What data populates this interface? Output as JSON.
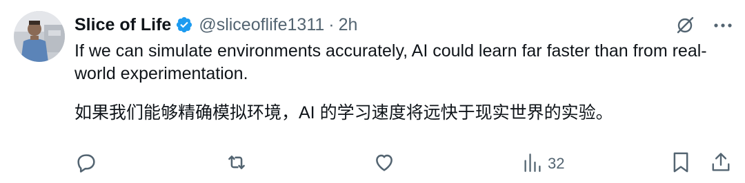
{
  "tweet": {
    "author_name": "Slice of Life",
    "handle": "@sliceoflife1311",
    "separator": "·",
    "time": "2h",
    "text_en": "If we can simulate environments accurately, AI could learn far faster than from real-world experimentation.",
    "text_zh": "如果我们能够精确模拟环境，AI 的学习速度将远快于现实世界的实验。"
  },
  "actions": {
    "views_count": "32"
  },
  "colors": {
    "text_primary": "#0f1419",
    "text_secondary": "#536471",
    "verified_badge": "#1d9bf0"
  },
  "icons": [
    "verified-badge-icon",
    "grok-icon",
    "more-icon",
    "reply-icon",
    "retweet-icon",
    "like-icon",
    "views-icon",
    "bookmark-icon",
    "share-icon"
  ]
}
